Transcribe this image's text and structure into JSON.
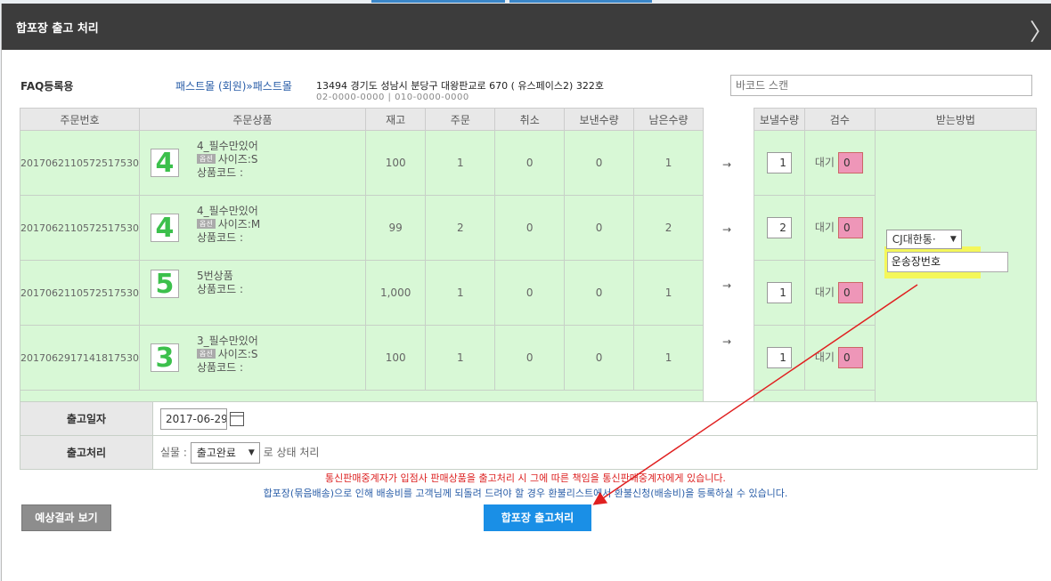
{
  "modal": {
    "title": "합포장 출고 처리"
  },
  "store": "FAQ등록용",
  "buyer": {
    "member": "패스트몰 (회원)",
    "name": "»패스트몰"
  },
  "address": "13494 경기도 성남시 분당구 대왕판교로 670 ( 유스페이스2) 322호",
  "phones": "02-0000-0000 | 010-0000-0000",
  "barcode_placeholder": "바코드 스캔",
  "columns": [
    "주문번호",
    "주문상품",
    "재고",
    "주문",
    "취소",
    "보낸수량",
    "남은수량"
  ],
  "right_columns": [
    "보낼수량",
    "검수",
    "받는방법"
  ],
  "option_badge": "옵션",
  "rows": [
    {
      "order_no": "2017062110572517530",
      "thumb": "4",
      "name": "4_필수만있어",
      "option": "사이즈:S",
      "code": "상품코드 :",
      "stock": "100",
      "order": "1",
      "cancel": "0",
      "sent": "0",
      "remain": "1",
      "send_qty": "1",
      "check": "대기",
      "check_count": "0"
    },
    {
      "order_no": "2017062110572517530",
      "thumb": "4",
      "name": "4_필수만있어",
      "option": "사이즈:M",
      "code": "상품코드 :",
      "stock": "99",
      "order": "2",
      "cancel": "0",
      "sent": "0",
      "remain": "2",
      "send_qty": "2",
      "check": "대기",
      "check_count": "0"
    },
    {
      "order_no": "2017062110572517530",
      "thumb": "5",
      "name": "5번상품",
      "option": "",
      "code": "상품코드 :",
      "stock": "1,000",
      "order": "1",
      "cancel": "0",
      "sent": "0",
      "remain": "1",
      "send_qty": "1",
      "check": "대기",
      "check_count": "0"
    },
    {
      "order_no": "2017062917141817530",
      "thumb": "3",
      "name": "3_필수만있어",
      "option": "사이즈:S",
      "code": "상품코드 :",
      "stock": "100",
      "order": "1",
      "cancel": "0",
      "sent": "0",
      "remain": "1",
      "send_qty": "1",
      "check": "대기",
      "check_count": "0"
    }
  ],
  "arrow": "→",
  "delivery": {
    "carrier": "CJ대한통·",
    "tracking_placeholder": "운송장번호"
  },
  "ship_date": {
    "label": "출고일자",
    "value": "2017-06-29"
  },
  "ship_process": {
    "label": "출고처리",
    "prefix": "실물 :",
    "status": "출고완료",
    "suffix": "로 상태 처리"
  },
  "notices": [
    "통신판매중계자가 입점사 판매상품을 출고처리 시 그에 따른 책임을 통신판매중계자에게 있습니다.",
    "합포장(묶음배송)으로 인해 배송비를 고객님께 되돌려 드려야 할 경우 환불리스트에서 환불신청(배송비)을 등록하실 수 있습니다."
  ],
  "buttons": {
    "preview": "예상결과 보기",
    "submit": "합포장 출고처리"
  },
  "colors": {
    "row_bg": "#d8f8d6",
    "highlight": "#f4f75a",
    "annotation": "#e02020",
    "submit": "#1a8fe6"
  }
}
